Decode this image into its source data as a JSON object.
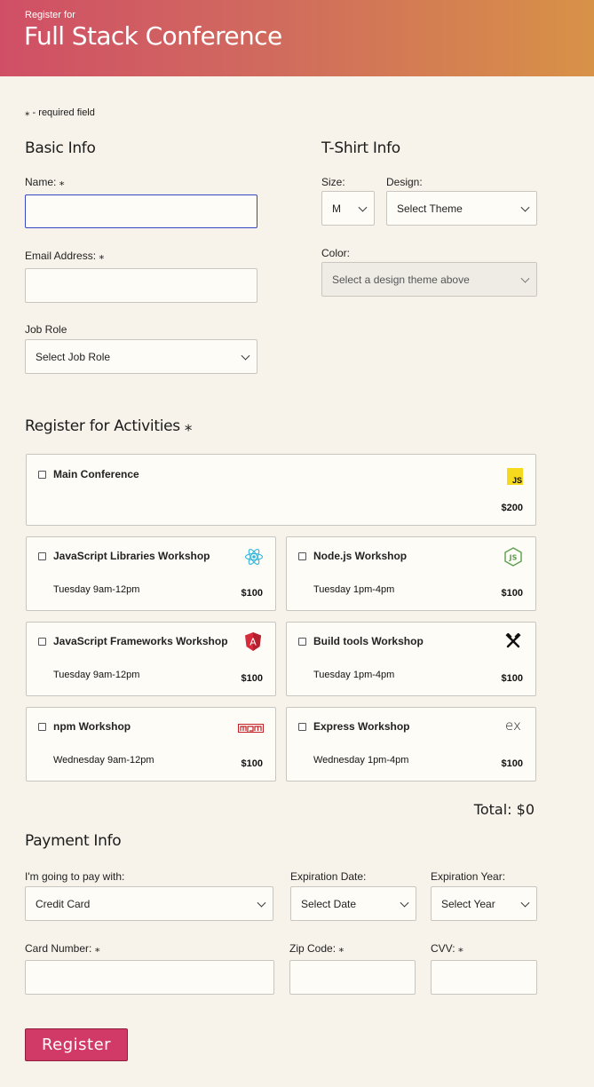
{
  "header": {
    "subtitle": "Register for",
    "title": "Full Stack Conference"
  },
  "required_note": "⁎ - required field",
  "basic": {
    "heading": "Basic Info",
    "name_label": "Name: ⁎",
    "email_label": "Email Address: ⁎",
    "job_label": "Job Role",
    "job_value": "Select Job Role"
  },
  "tshirt": {
    "heading": "T-Shirt Info",
    "size_label": "Size:",
    "size_value": "M",
    "design_label": "Design:",
    "design_value": "Select Theme",
    "color_label": "Color:",
    "color_value": "Select a design theme above"
  },
  "activities": {
    "heading": "Register for Activities ⁎",
    "items": [
      {
        "title": "Main Conference",
        "time": "",
        "cost": "$200",
        "icon": "js-icon"
      },
      {
        "title": "JavaScript Libraries Workshop",
        "time": "Tuesday 9am-12pm",
        "cost": "$100",
        "icon": "react-icon"
      },
      {
        "title": "Node.js Workshop",
        "time": "Tuesday 1pm-4pm",
        "cost": "$100",
        "icon": "nodejs-icon"
      },
      {
        "title": "JavaScript Frameworks Workshop",
        "time": "Tuesday 9am-12pm",
        "cost": "$100",
        "icon": "angular-icon"
      },
      {
        "title": "Build tools Workshop",
        "time": "Tuesday 1pm-4pm",
        "cost": "$100",
        "icon": "tools-icon"
      },
      {
        "title": "npm Workshop",
        "time": "Wednesday 9am-12pm",
        "cost": "$100",
        "icon": "npm-icon"
      },
      {
        "title": "Express Workshop",
        "time": "Wednesday 1pm-4pm",
        "cost": "$100",
        "icon": "express-icon"
      }
    ],
    "total": "Total: $0"
  },
  "payment": {
    "heading": "Payment Info",
    "method_label": "I'm going to pay with:",
    "method_value": "Credit Card",
    "exp_date_label": "Expiration Date:",
    "exp_date_value": "Select Date",
    "exp_year_label": "Expiration Year:",
    "exp_year_value": "Select Year",
    "card_label": "Card Number: ⁎",
    "zip_label": "Zip Code: ⁎",
    "cvv_label": "CVV: ⁎"
  },
  "register_button": "Register",
  "colors": {
    "accent": "#d13a66",
    "focus_border": "#3646c4",
    "background": "#f7f3ea"
  }
}
